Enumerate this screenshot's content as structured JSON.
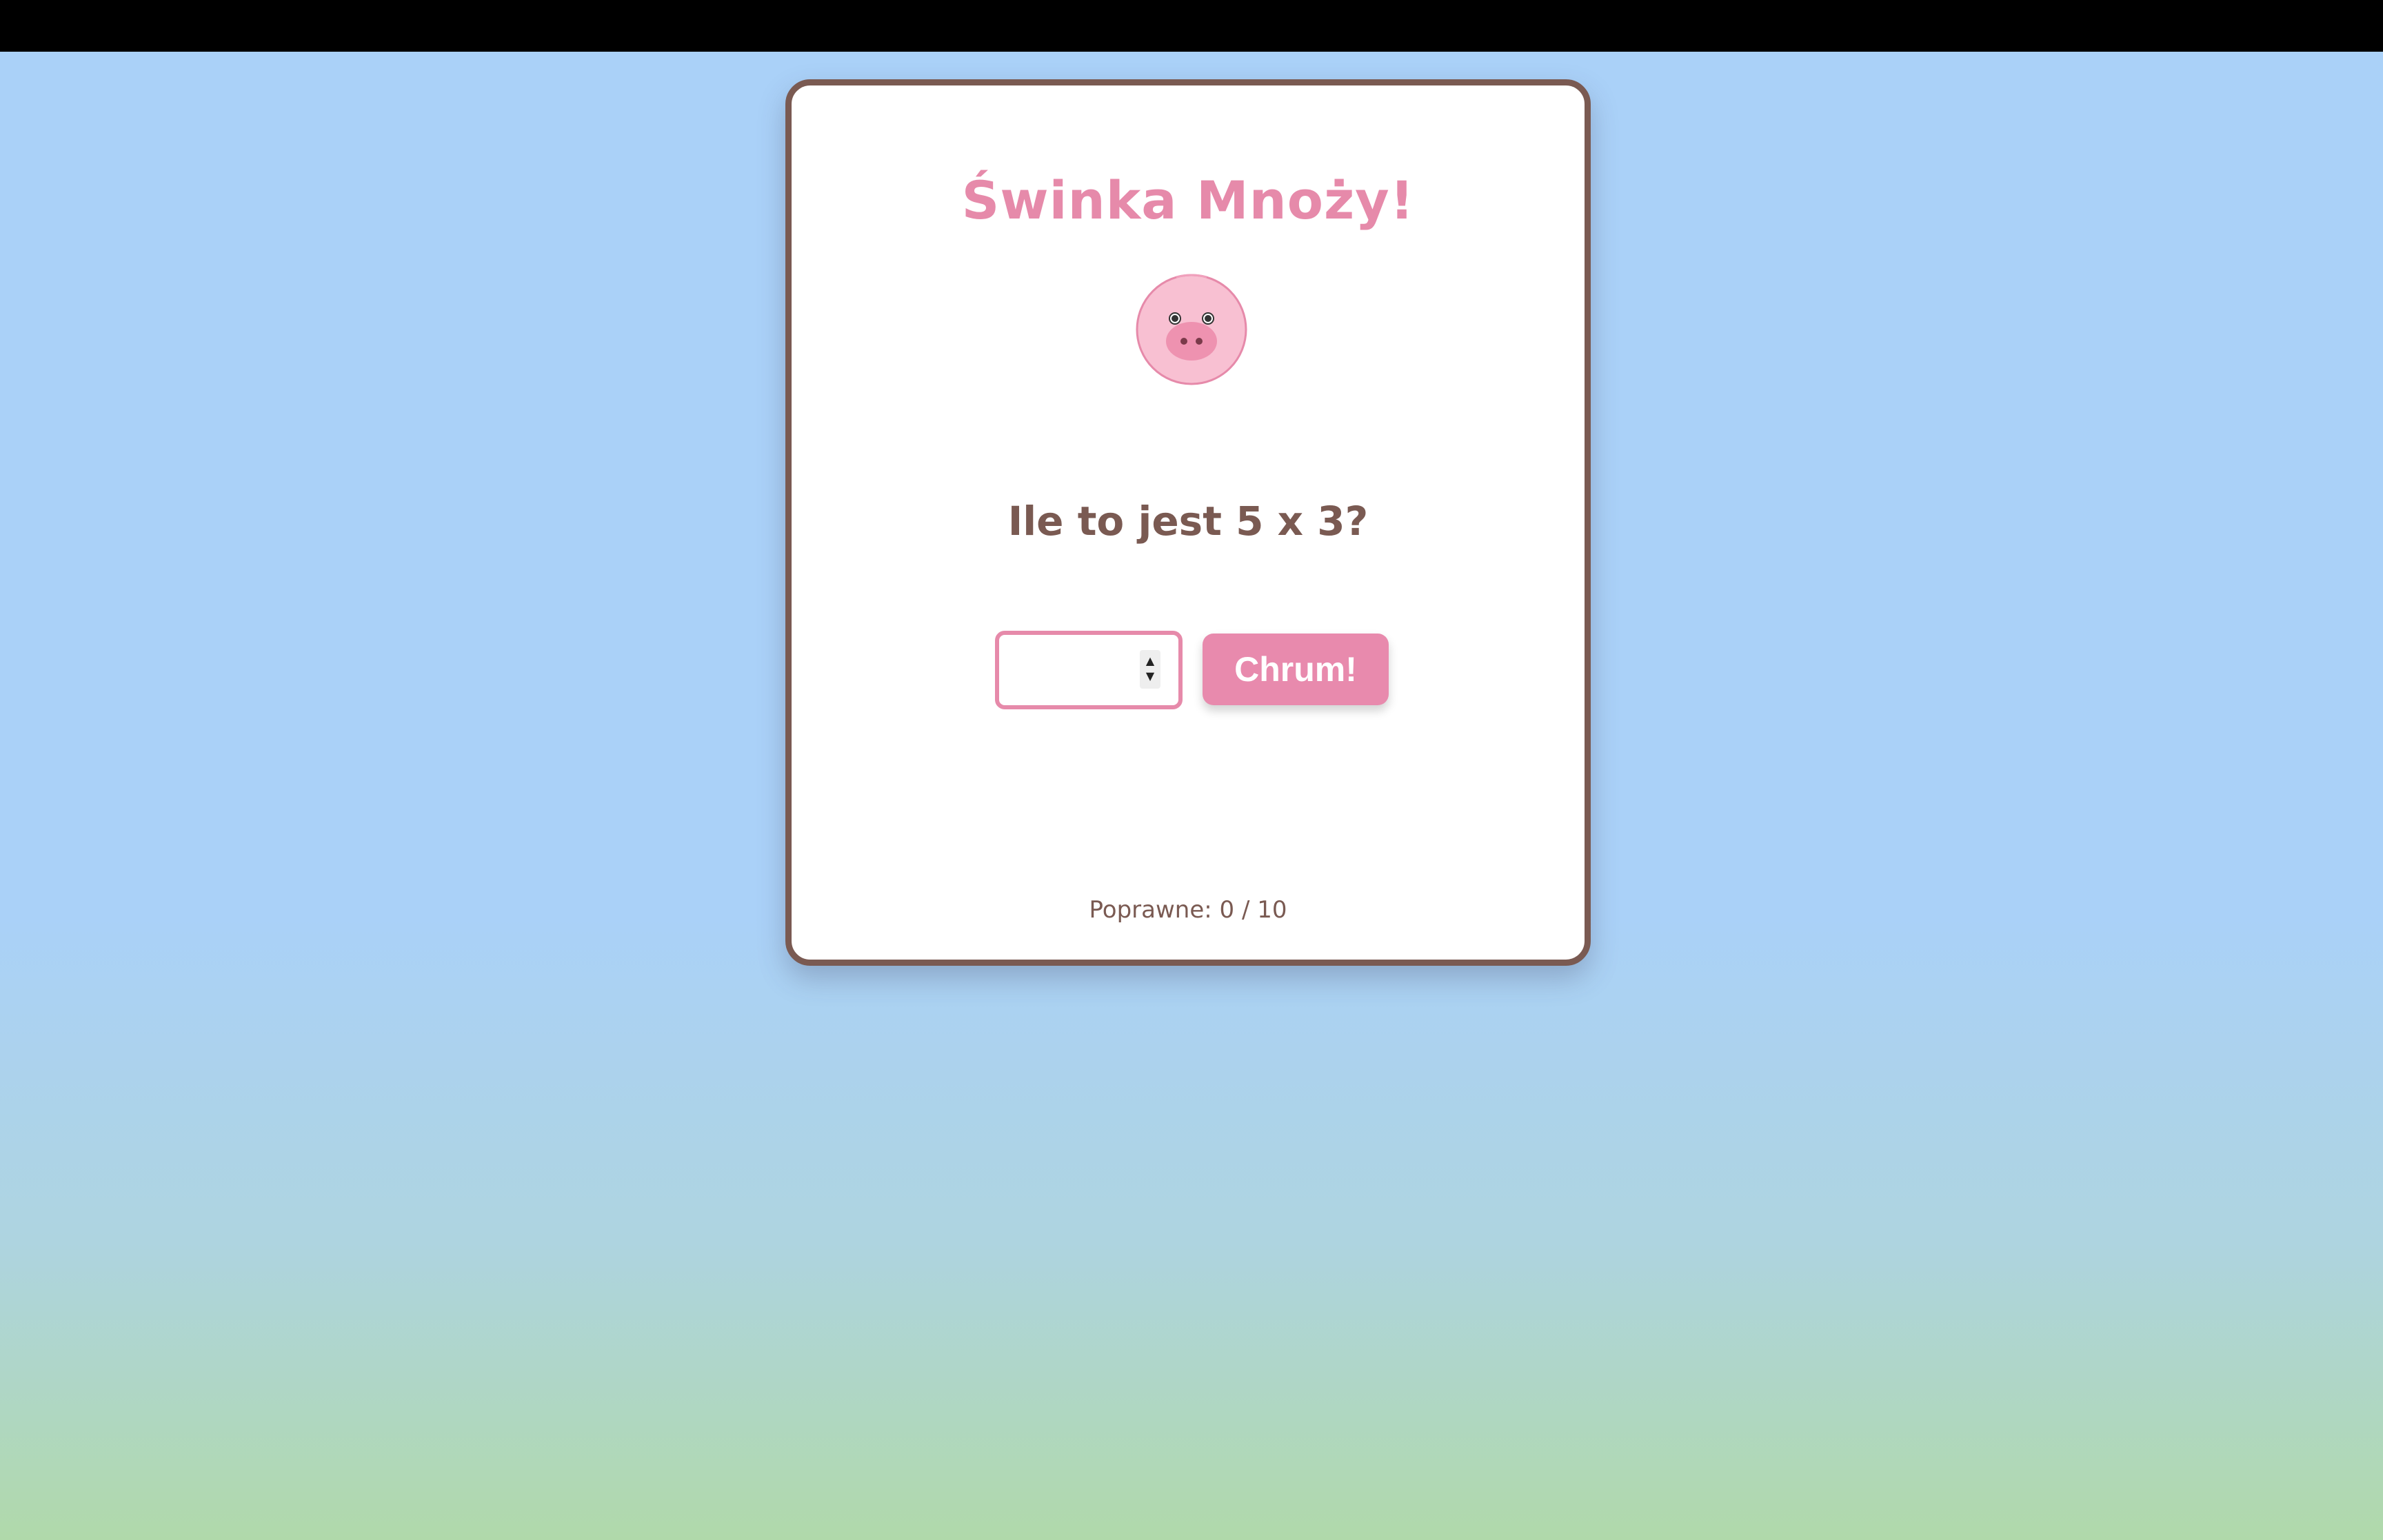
{
  "game": {
    "title": "Świnka Mnoży!",
    "mascot_icon": "pig-face-icon",
    "question": "Ile to jest 5 x 3?",
    "answer": {
      "value": "",
      "placeholder": ""
    },
    "submit_label": "Chrum!",
    "score_text": "Poprawne: 0 / 10"
  },
  "colors": {
    "accent_pink": "#e88aad",
    "text_brown": "#7a5a52",
    "card_border": "#7a5a52",
    "sky_blue": "#aad1f8",
    "grass_green": "#b0d9aa"
  }
}
